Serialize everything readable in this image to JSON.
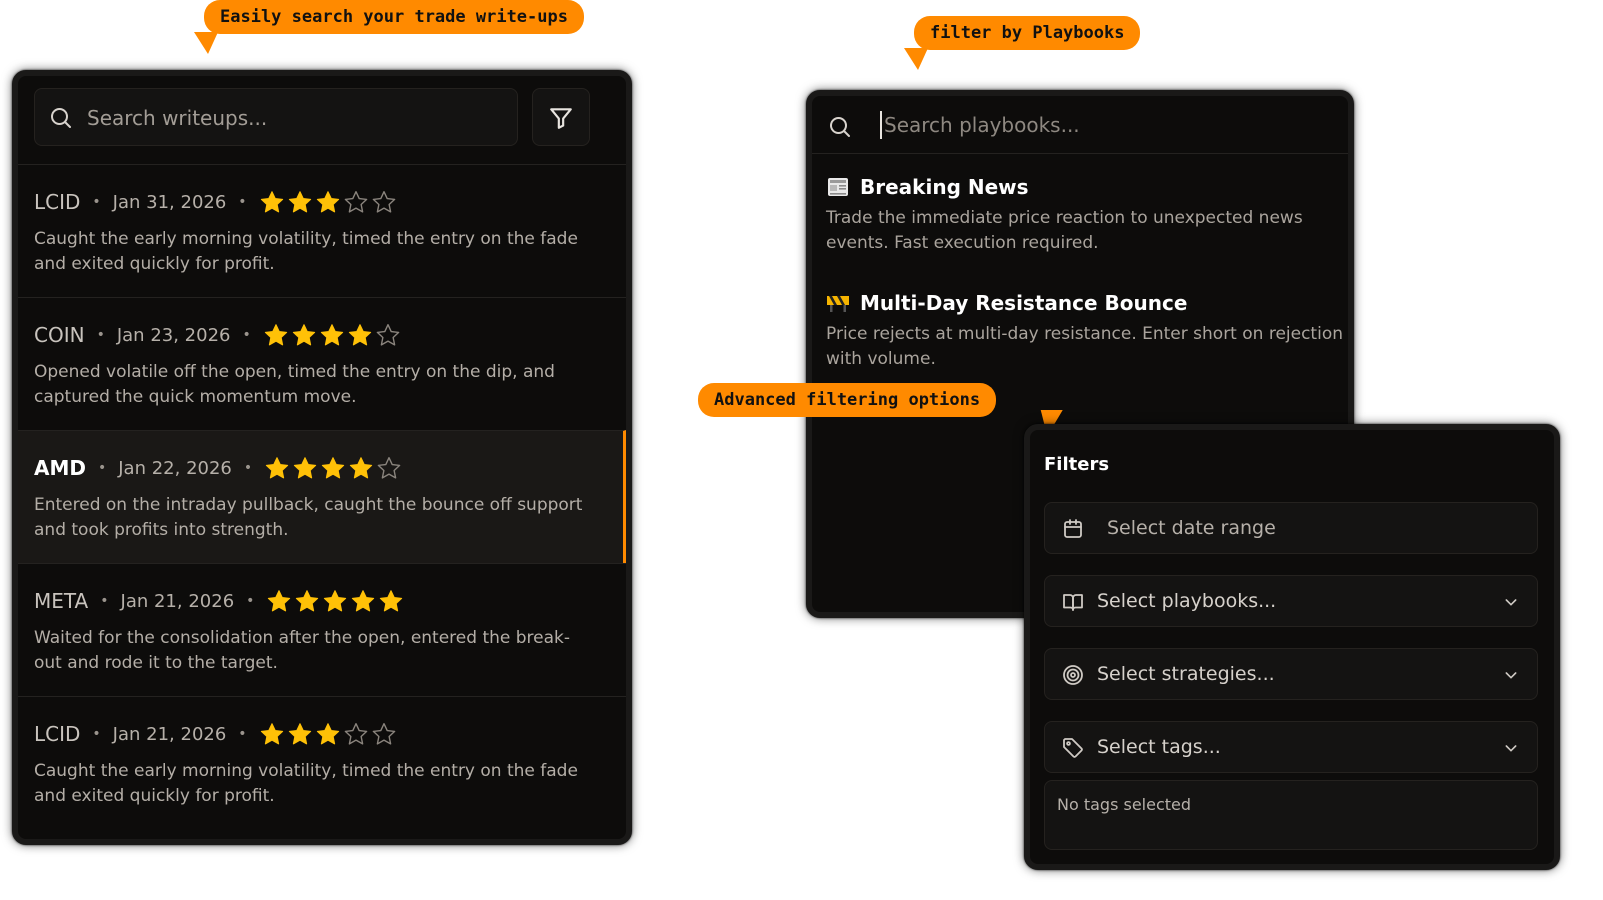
{
  "callouts": {
    "search": "Easily search your trade write-ups",
    "playbooks": "filter by Playbooks",
    "advanced": "Advanced filtering options"
  },
  "colors": {
    "accent": "#ff8a00",
    "star": "#ffc107",
    "panel_bg": "#0d0c0b"
  },
  "writeups": {
    "search_placeholder": "Search writeups...",
    "search_icon": "search-icon",
    "filter_icon": "filter-icon",
    "items": [
      {
        "ticker": "LCID",
        "date": "Jan 31, 2026",
        "rating": 3,
        "max_rating": 5,
        "note": "Caught the early morning volatility, timed the entry on the fade and exited quickly for profit.",
        "active": false
      },
      {
        "ticker": "COIN",
        "date": "Jan 23, 2026",
        "rating": 4,
        "max_rating": 5,
        "note": "Opened volatile off the open, timed the entry on the dip, and captured the quick momentum move.",
        "active": false
      },
      {
        "ticker": "AMD",
        "date": "Jan 22, 2026",
        "rating": 4,
        "max_rating": 5,
        "note": "Entered on the intraday pullback, caught the bounce off support and took profits into strength.",
        "active": true
      },
      {
        "ticker": "META",
        "date": "Jan 21, 2026",
        "rating": 5,
        "max_rating": 5,
        "note": "Waited for the consolidation after the open, entered the break-out and rode it to the target.",
        "active": false
      },
      {
        "ticker": "LCID",
        "date": "Jan 21, 2026",
        "rating": 3,
        "max_rating": 5,
        "note": "Caught the early morning volatility, timed the entry on the fade and exited quickly for profit.",
        "active": false
      }
    ]
  },
  "playbooks": {
    "search_placeholder": "Search playbooks...",
    "items": [
      {
        "icon": "newspaper-icon",
        "title": "Breaking News",
        "description": "Trade the immediate price reaction to unexpected news events. Fast execution required."
      },
      {
        "icon": "barrier-icon",
        "title": "Multi-Day Resistance Bounce",
        "description": "Price rejects at multi-day resistance. Enter short on rejection with volume."
      }
    ]
  },
  "filters": {
    "title": "Filters",
    "date_range": "Select date range",
    "playbooks": "Select playbooks...",
    "strategies": "Select strategies...",
    "tags": "Select tags...",
    "tags_empty": "No tags selected"
  }
}
